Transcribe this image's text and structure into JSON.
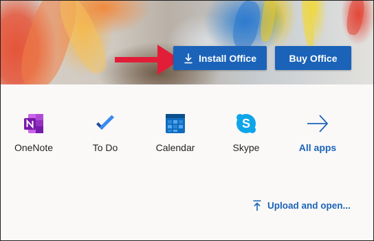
{
  "hero": {
    "install_label": "Install Office",
    "buy_label": "Buy Office",
    "install_icon": "download-icon",
    "annotation_icon": "red-arrow-icon",
    "annotation_color": "#e21d38"
  },
  "apps": [
    {
      "label": "OneNote",
      "icon": "onenote-icon"
    },
    {
      "label": "To Do",
      "icon": "todo-icon"
    },
    {
      "label": "Calendar",
      "icon": "calendar-icon"
    },
    {
      "label": "Skype",
      "icon": "skype-icon"
    },
    {
      "label": "All apps",
      "icon": "arrow-right-icon"
    }
  ],
  "upload": {
    "label": "Upload and open...",
    "icon": "upload-icon"
  },
  "colors": {
    "accent": "#1b63b8",
    "onenote": "#7719aa",
    "todo": "#2564cf",
    "calendar": "#0f6cbd",
    "skype": "#0ea5e9"
  }
}
